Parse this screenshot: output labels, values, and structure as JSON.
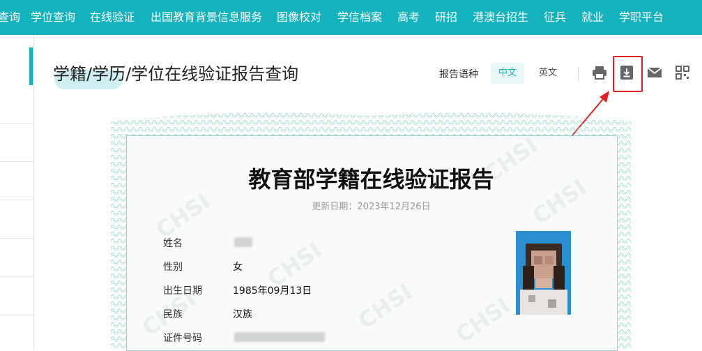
{
  "nav": {
    "items": [
      "查询",
      "学位查询",
      "在线验证",
      "出国教育背景信息服务",
      "图像校对",
      "学信档案",
      "高考",
      "研招",
      "港澳台招生",
      "征兵",
      "就业",
      "学职平台"
    ]
  },
  "header": {
    "title": "学籍/学历/学位在线验证报告查询"
  },
  "toolbar": {
    "lang_label": "报告语种",
    "lang_zh": "中文",
    "lang_en": "英文",
    "icons": [
      "print-icon",
      "download-icon",
      "mail-icon",
      "qrcode-icon"
    ]
  },
  "report": {
    "watermark": "CHSI",
    "title": "教育部学籍在线验证报告",
    "updated": "更新日期：2023年12月26日",
    "fields": [
      {
        "label": "姓名",
        "value": ""
      },
      {
        "label": "性别",
        "value": "女"
      },
      {
        "label": "出生日期",
        "value": "1985年09月13日"
      },
      {
        "label": "民族",
        "value": "汉族"
      },
      {
        "label": "证件号码",
        "value": ""
      }
    ]
  },
  "colors": {
    "brand": "#14b2bc",
    "annotation": "#e02020",
    "border": "#8fd3cb"
  }
}
